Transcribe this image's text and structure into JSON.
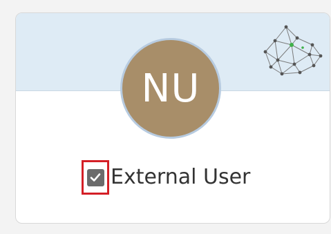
{
  "user_card": {
    "avatar": {
      "initials": "NU",
      "background_color": "#a88e69"
    },
    "banner_icon": "network-graph-icon",
    "checkbox": {
      "checked": true,
      "icon": "checkmark-icon",
      "focused": true
    },
    "label": "External User"
  },
  "colors": {
    "banner": "#deebf5",
    "focus_outline": "#d41f26",
    "checkbox_fill": "#6b6b6b",
    "text": "#333333"
  }
}
